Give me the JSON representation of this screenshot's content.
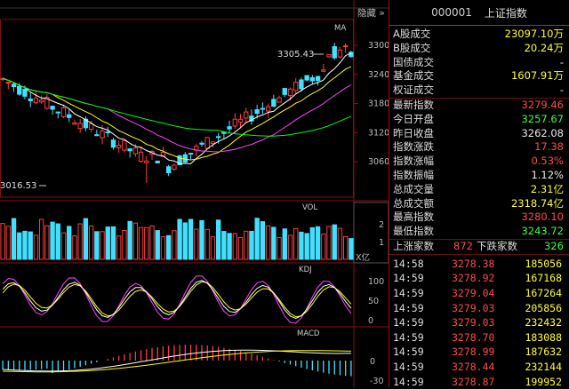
{
  "toolbar": {
    "hide_label": "隐藏",
    "hide_icon": "double-chevron-right-icon"
  },
  "header": {
    "code": "000001",
    "name": "上证指数"
  },
  "main_chart": {
    "label": "MA",
    "high_annot": "3305.43",
    "low_annot": "3016.53",
    "y_ticks": [
      "3300",
      "3240",
      "3180",
      "3120",
      "3060"
    ]
  },
  "vol_panel": {
    "label": "VOL",
    "unit": "X亿",
    "y_ticks": [
      "2",
      "1"
    ]
  },
  "kdj_panel": {
    "label": "KDJ",
    "y_ticks": [
      "100",
      "50",
      "0"
    ]
  },
  "macd_panel": {
    "label": "MACD",
    "y_ticks": [
      "0",
      "-30"
    ]
  },
  "stats": {
    "group1": [
      {
        "label": "A股成交",
        "value": "23097.10万",
        "cls": "yel"
      },
      {
        "label": "B股成交",
        "value": "20.24万",
        "cls": "yel"
      },
      {
        "label": "国债成交",
        "value": "-",
        "cls": "wht"
      },
      {
        "label": "基金成交",
        "value": "1607.91万",
        "cls": "yel"
      },
      {
        "label": "权证成交",
        "value": "-",
        "cls": "wht"
      }
    ],
    "group2": [
      {
        "label": "最新指数",
        "value": "3279.46",
        "cls": "red"
      },
      {
        "label": "今日开盘",
        "value": "3257.67",
        "cls": "green"
      },
      {
        "label": "昨日收盘",
        "value": "3262.08",
        "cls": "wht"
      },
      {
        "label": "指数涨跌",
        "value": "17.38",
        "cls": "red"
      },
      {
        "label": "指数涨幅",
        "value": "0.53%",
        "cls": "red"
      },
      {
        "label": "指数振幅",
        "value": "1.12%",
        "cls": "wht"
      },
      {
        "label": "总成交量",
        "value": "2.31亿",
        "cls": "yel"
      },
      {
        "label": "总成交额",
        "value": "2318.74亿",
        "cls": "yel"
      },
      {
        "label": "最高指数",
        "value": "3280.10",
        "cls": "red"
      },
      {
        "label": "最低指数",
        "value": "3243.72",
        "cls": "green"
      }
    ],
    "updown": {
      "up_label": "上涨家数",
      "up_value": "872",
      "down_label": "下跌家数",
      "down_value": "326"
    }
  },
  "ticks": [
    {
      "time": "14:58",
      "price": "3278.38",
      "vol": "185056"
    },
    {
      "time": "14:59",
      "price": "3278.92",
      "vol": "167168"
    },
    {
      "time": "14:59",
      "price": "3279.04",
      "vol": "167264"
    },
    {
      "time": "14:59",
      "price": "3279.03",
      "vol": "205856"
    },
    {
      "time": "14:59",
      "price": "3279.03",
      "vol": "232432"
    },
    {
      "time": "14:59",
      "price": "3278.70",
      "vol": "183088"
    },
    {
      "time": "14:59",
      "price": "3278.99",
      "vol": "187632"
    },
    {
      "time": "14:59",
      "price": "3278.44",
      "vol": "232144"
    },
    {
      "time": "14:59",
      "price": "3278.87",
      "vol": "199952"
    }
  ],
  "colors": {
    "up": "#ff3c3c",
    "down": "#40e0ff",
    "ma5": "#ffffff",
    "ma10": "#ffff00",
    "ma20": "#ff44ff",
    "ma60": "#00ff00"
  }
}
